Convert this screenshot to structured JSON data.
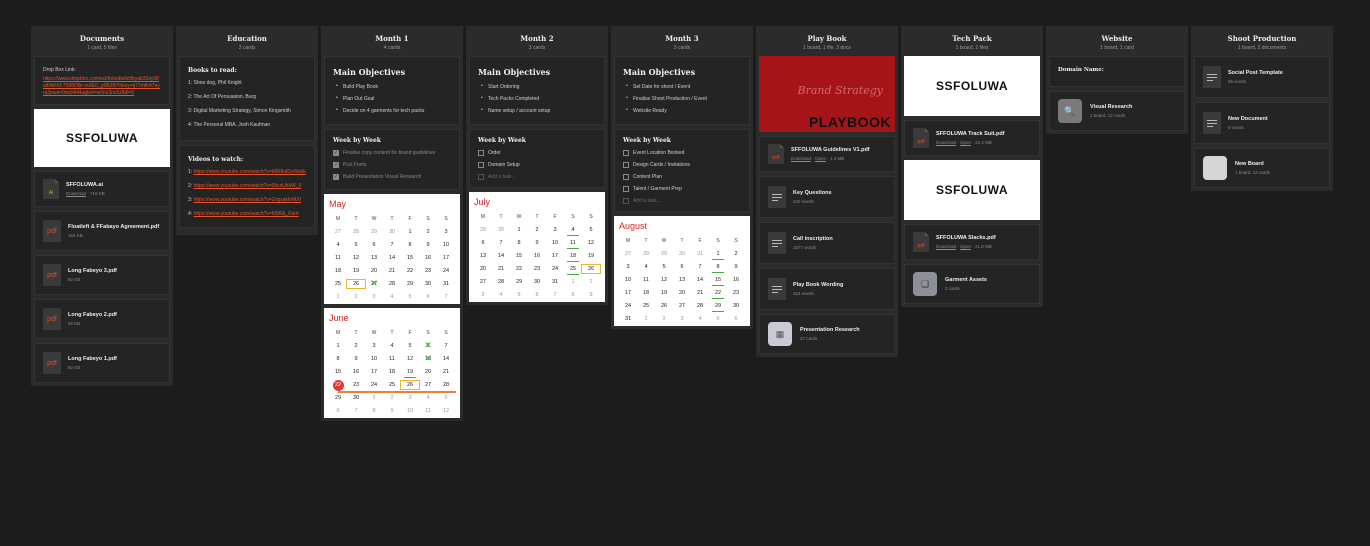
{
  "columns": {
    "documents": {
      "title": "Documents",
      "sub": "1 card, 5 files",
      "dropbox_label": "Drop Box Link:",
      "dropbox_url": "https://www.dropbox.com/scl/fo/eubwfz8byab33zy08alf/AKKF7588OBr-mXE0_g0B2f0?rlkey=ij77mfh47eyrq3pwsn0wdxfi44ugkst=w0nu3nx5z8dl=0",
      "brand": "SSFOLUWA",
      "ai_file": {
        "icon": "Ai",
        "name": "SFFOLUWA.ai",
        "action": "Download",
        "size": "715 KB"
      },
      "files": [
        {
          "icon": "pdf",
          "name": "Floatleft & FFabayo Agreement.pdf",
          "size": "164 KB"
        },
        {
          "icon": "pdf",
          "name": "Long Fabeyo 3.pdf",
          "size": "82 KB"
        },
        {
          "icon": "pdf",
          "name": "Long Fabeyo 2.pdf",
          "size": "82 KB"
        },
        {
          "icon": "pdf",
          "name": "Long Fabeyo 1.pdf",
          "size": "82 KB"
        }
      ]
    },
    "education": {
      "title": "Education",
      "sub": "2 cards",
      "books_title": "Books to read:",
      "books": [
        "1: Shoe dog, Phil Knight",
        "2: The Art Of Persuasion, Burg",
        "3: Digital Marketing Strategy, Simon Kingsmith",
        "4: The Personal MBA, Josh Kaufman"
      ],
      "videos_title": "Videos to watch:",
      "videos": [
        {
          "n": "1: ",
          "url": "https://www.youtube.com/watch?v=k8RIkdDxWakk"
        },
        {
          "n": "2: ",
          "url": "https://www.youtube.com/watch?v=9kcxUhkW_0"
        },
        {
          "n": "3: ",
          "url": "https://www.youtube.com/watch?v=ZvgxakInMXI"
        },
        {
          "n": "4: ",
          "url": "https://www.youtube.com/watch?v=KBR&_Farrl"
        }
      ]
    },
    "month1": {
      "title": "Month 1",
      "sub": "4 cards",
      "main_title": "Main Objectives",
      "objectives": [
        "Build Play Book",
        "Plan Out Goal",
        "Decide on 4 garments for tech packs"
      ],
      "week_title": "Week by Week",
      "tasks": [
        {
          "label": "Finalise copy content for brand guidelines",
          "done": true
        },
        {
          "label": "Pick Fonts",
          "done": true
        },
        {
          "label": "Build Presentation Visual Research",
          "done": true
        }
      ],
      "cal_may": "May",
      "cal_june": "June"
    },
    "month2": {
      "title": "Month 2",
      "sub": "3 cards",
      "main_title": "Main Objectives",
      "objectives": [
        "Start Ordering",
        "Tech Packs Completed",
        "Name setup / account setup"
      ],
      "week_title": "Week by Week",
      "tasks": [
        {
          "label": "Order",
          "done": false
        },
        {
          "label": "Domain Setup",
          "done": false
        }
      ],
      "add_task": "Add a task...",
      "cal_july": "July"
    },
    "month3": {
      "title": "Month 3",
      "sub": "3 cards",
      "main_title": "Main Objectives",
      "objectives": [
        "Set Date for shoot / Event",
        "Finalise Shoot Production / Event",
        "Website Ready"
      ],
      "week_title": "Week by Week",
      "tasks": [
        {
          "label": "Event Location Booked",
          "done": false
        },
        {
          "label": "Design Cards / Invitations",
          "done": false
        },
        {
          "label": "Content Plan",
          "done": false
        },
        {
          "label": "Talent / Garment Prep",
          "done": false
        }
      ],
      "add_task": "Add a task...",
      "cal_august": "August"
    },
    "playbook": {
      "title": "Play Book",
      "sub": "1 board, 1 file, 3 docs",
      "img_script": "Brand Strategy",
      "img_title": "PLAYBOOK",
      "guide": {
        "name": "SFFOLUWA Guidelines V1.pdf",
        "download": "Download",
        "open": "Open",
        "size": "1.4 MB"
      },
      "docs": [
        {
          "name": "Key Questions",
          "meta": "343 words"
        },
        {
          "name": "Call inscription",
          "meta": "1677 words"
        },
        {
          "name": "Play Book Wording",
          "meta": "424 words"
        }
      ],
      "board": {
        "name": "Presentation Research",
        "meta": "27 cards"
      }
    },
    "techpack": {
      "title": "Tech Pack",
      "sub": "1 board, 2 files",
      "brand": "SSFOLUWA",
      "files": [
        {
          "name": "SFFOLUWA Track Suit.pdf",
          "download": "Download",
          "open": "Open",
          "size": "22.3 MB"
        },
        {
          "name": "SFFOLUWA Slacks.pdf",
          "download": "Download",
          "open": "Open",
          "size": "21.8 MB"
        }
      ],
      "board": {
        "name": "Garment Assets",
        "meta": "2 cards"
      }
    },
    "website": {
      "title": "Website",
      "sub": "1 board, 1 card",
      "domain_label": "Domain Name:",
      "board": {
        "name": "Visual Research",
        "meta": "1 board, 12 cards"
      }
    },
    "shoot": {
      "title": "Shoot Production",
      "sub": "1 board, 2 documents",
      "docs": [
        {
          "name": "Social Post Template",
          "meta": "65 words"
        },
        {
          "name": "New Document",
          "meta": "0 words"
        }
      ],
      "board": {
        "name": "New Board",
        "meta": "1 board, 12 cards"
      }
    }
  },
  "calendar": {
    "dow": [
      "M",
      "T",
      "W",
      "T",
      "F",
      "S",
      "S"
    ],
    "may": [
      [
        "27",
        "m"
      ],
      [
        "28",
        "m"
      ],
      [
        "29",
        "m"
      ],
      [
        "30",
        "m"
      ],
      [
        "1",
        ""
      ],
      [
        "2",
        ""
      ],
      [
        "3",
        ""
      ],
      [
        "4",
        ""
      ],
      [
        "5",
        ""
      ],
      [
        "6",
        ""
      ],
      [
        "7",
        ""
      ],
      [
        "8",
        ""
      ],
      [
        "9",
        ""
      ],
      [
        "10",
        ""
      ],
      [
        "11",
        ""
      ],
      [
        "12",
        ""
      ],
      [
        "13",
        ""
      ],
      [
        "14",
        ""
      ],
      [
        "15",
        ""
      ],
      [
        "16",
        ""
      ],
      [
        "17",
        ""
      ],
      [
        "18",
        ""
      ],
      [
        "19",
        ""
      ],
      [
        "20",
        ""
      ],
      [
        "21",
        ""
      ],
      [
        "22",
        ""
      ],
      [
        "23",
        ""
      ],
      [
        "24",
        ""
      ],
      [
        "25",
        ""
      ],
      [
        "26",
        "box"
      ],
      [
        "27",
        "xm"
      ],
      [
        "28",
        ""
      ],
      [
        "29",
        ""
      ],
      [
        "30",
        ""
      ],
      [
        "31",
        ""
      ],
      [
        "1",
        "m"
      ],
      [
        "2",
        "m"
      ],
      [
        "3",
        "m"
      ],
      [
        "4",
        "m"
      ],
      [
        "5",
        "m"
      ],
      [
        "6",
        "m"
      ],
      [
        "7",
        "m"
      ]
    ],
    "june": [
      [
        "1",
        ""
      ],
      [
        "2",
        ""
      ],
      [
        "3",
        ""
      ],
      [
        "4",
        ""
      ],
      [
        "5",
        ""
      ],
      [
        "6",
        "xm"
      ],
      [
        "7",
        ""
      ],
      [
        "8",
        ""
      ],
      [
        "9",
        ""
      ],
      [
        "10",
        ""
      ],
      [
        "11",
        ""
      ],
      [
        "12",
        ""
      ],
      [
        "13",
        "xm"
      ],
      [
        "14",
        ""
      ],
      [
        "15",
        ""
      ],
      [
        "16",
        ""
      ],
      [
        "17",
        ""
      ],
      [
        "18",
        ""
      ],
      [
        "19",
        "ul"
      ],
      [
        "20",
        ""
      ],
      [
        "21",
        ""
      ],
      [
        "22",
        "dot"
      ],
      [
        "23",
        ""
      ],
      [
        "24",
        ""
      ],
      [
        "25",
        ""
      ],
      [
        "26",
        "box"
      ],
      [
        "27",
        ""
      ],
      [
        "28",
        ""
      ],
      [
        "29",
        ""
      ],
      [
        "30",
        ""
      ],
      [
        "1",
        "m"
      ],
      [
        "2",
        "m"
      ],
      [
        "3",
        "m"
      ],
      [
        "4",
        "m"
      ],
      [
        "5",
        "m"
      ],
      [
        "6",
        "m"
      ],
      [
        "7",
        "m"
      ],
      [
        "8",
        "m"
      ],
      [
        "9",
        "m"
      ],
      [
        "10",
        "m"
      ],
      [
        "11",
        "m"
      ],
      [
        "12",
        "m"
      ]
    ],
    "july": [
      [
        "29",
        "m"
      ],
      [
        "30",
        "m"
      ],
      [
        "1",
        ""
      ],
      [
        "2",
        ""
      ],
      [
        "3",
        ""
      ],
      [
        "4",
        "ul"
      ],
      [
        "5",
        ""
      ],
      [
        "6",
        ""
      ],
      [
        "7",
        ""
      ],
      [
        "8",
        ""
      ],
      [
        "9",
        ""
      ],
      [
        "10",
        ""
      ],
      [
        "11",
        "ul"
      ],
      [
        "12",
        ""
      ],
      [
        "13",
        ""
      ],
      [
        "14",
        ""
      ],
      [
        "15",
        ""
      ],
      [
        "16",
        ""
      ],
      [
        "17",
        ""
      ],
      [
        "18",
        "ul"
      ],
      [
        "19",
        ""
      ],
      [
        "20",
        ""
      ],
      [
        "21",
        ""
      ],
      [
        "22",
        ""
      ],
      [
        "23",
        ""
      ],
      [
        "24",
        ""
      ],
      [
        "25",
        "ul"
      ],
      [
        "26",
        "box"
      ],
      [
        "27",
        ""
      ],
      [
        "28",
        ""
      ],
      [
        "29",
        ""
      ],
      [
        "30",
        ""
      ],
      [
        "31",
        ""
      ],
      [
        "1",
        "m"
      ],
      [
        "2",
        "m"
      ],
      [
        "3",
        "m"
      ],
      [
        "4",
        "m"
      ],
      [
        "5",
        "m"
      ],
      [
        "6",
        "m"
      ],
      [
        "7",
        "m"
      ],
      [
        "8",
        "m"
      ],
      [
        "9",
        "m"
      ]
    ],
    "august": [
      [
        "27",
        "m"
      ],
      [
        "28",
        "m"
      ],
      [
        "29",
        "m"
      ],
      [
        "30",
        "m"
      ],
      [
        "31",
        "m"
      ],
      [
        "1",
        "ul"
      ],
      [
        "2",
        ""
      ],
      [
        "3",
        ""
      ],
      [
        "4",
        ""
      ],
      [
        "5",
        ""
      ],
      [
        "6",
        ""
      ],
      [
        "7",
        ""
      ],
      [
        "8",
        "ul"
      ],
      [
        "9",
        ""
      ],
      [
        "10",
        ""
      ],
      [
        "11",
        ""
      ],
      [
        "12",
        ""
      ],
      [
        "13",
        ""
      ],
      [
        "14",
        ""
      ],
      [
        "15",
        "ul"
      ],
      [
        "16",
        ""
      ],
      [
        "17",
        ""
      ],
      [
        "18",
        ""
      ],
      [
        "19",
        ""
      ],
      [
        "20",
        ""
      ],
      [
        "21",
        ""
      ],
      [
        "22",
        "ul"
      ],
      [
        "23",
        ""
      ],
      [
        "24",
        ""
      ],
      [
        "25",
        ""
      ],
      [
        "26",
        ""
      ],
      [
        "27",
        ""
      ],
      [
        "28",
        ""
      ],
      [
        "29",
        "ul"
      ],
      [
        "30",
        ""
      ],
      [
        "31",
        ""
      ],
      [
        "1",
        "m"
      ],
      [
        "2",
        "m"
      ],
      [
        "3",
        "m"
      ],
      [
        "4",
        "m"
      ],
      [
        "5",
        "m"
      ],
      [
        "6",
        "m"
      ]
    ]
  }
}
